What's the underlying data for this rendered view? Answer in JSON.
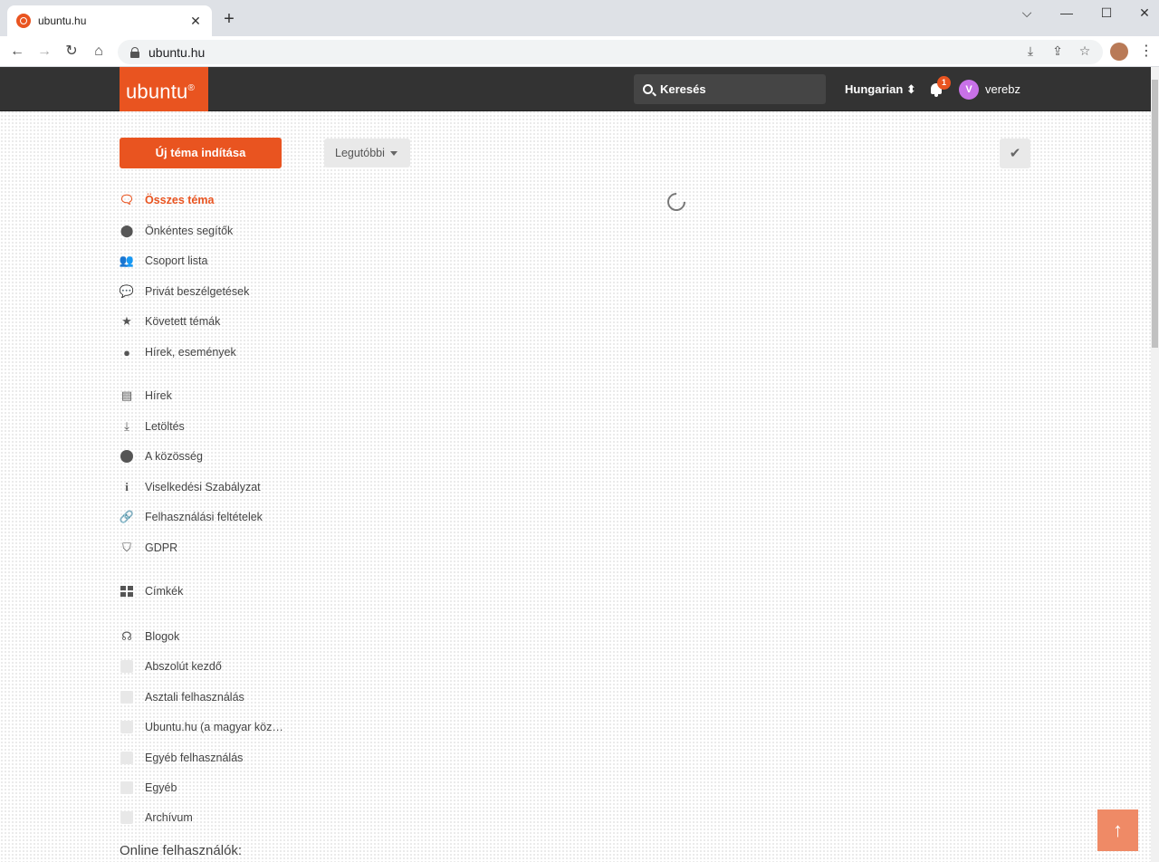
{
  "browser": {
    "tab_title": "ubuntu.hu",
    "tab_close": "✕",
    "new_tab": "+",
    "url": "ubuntu.hu",
    "window_controls": {
      "dropdown": "⌵",
      "minimize": "—",
      "maximize": "☐",
      "close": "✕"
    }
  },
  "header": {
    "logo_text": "ubuntu",
    "logo_mark": "®",
    "search_placeholder": "Keresés",
    "language": "Hungarian ⬍",
    "notification_count": "1",
    "avatar_letter": "V",
    "username": "verebz"
  },
  "main": {
    "new_topic_label": "Új téma indítása",
    "sort_label": "Legutóbbi",
    "check_symbol": "✔"
  },
  "sidebar": {
    "items": [
      {
        "label": "Összes téma",
        "icon": "chat-bubbles-icon",
        "active": true
      },
      {
        "label": "Önkéntes segítők",
        "icon": "map-pin-icon"
      },
      {
        "label": "Csoport lista",
        "icon": "users-icon"
      },
      {
        "label": "Privát beszélgetések",
        "icon": "comments-icon"
      },
      {
        "label": "Követett témák",
        "icon": "star-icon"
      },
      {
        "label": "Hírek, események",
        "icon": "comment-icon"
      },
      {
        "label": "Hírek",
        "icon": "newspaper-icon"
      },
      {
        "label": "Letöltés",
        "icon": "download-icon"
      },
      {
        "label": "A közösség",
        "icon": "circle-icon"
      },
      {
        "label": "Viselkedési Szabályzat",
        "icon": "info-icon"
      },
      {
        "label": "Felhasználási feltételek",
        "icon": "link-icon"
      },
      {
        "label": "GDPR",
        "icon": "shield-icon"
      },
      {
        "label": "Címkék",
        "icon": "tags-grid-icon"
      },
      {
        "label": "Blogok",
        "icon": "rss-icon"
      },
      {
        "label": "Abszolút kezdő",
        "icon": "category-square-icon"
      },
      {
        "label": "Asztali felhasználás",
        "icon": "category-square-icon"
      },
      {
        "label": "Ubuntu.hu (a magyar köz…",
        "icon": "category-square-icon"
      },
      {
        "label": "Egyéb felhasználás",
        "icon": "category-square-icon"
      },
      {
        "label": "Egyéb",
        "icon": "category-square-icon"
      },
      {
        "label": "Archívum",
        "icon": "category-square-icon"
      }
    ],
    "online_users_label": "Online felhasználók:"
  },
  "scroll_top_symbol": "↑",
  "colors": {
    "brand": "#e95420",
    "header_bg": "#333333",
    "avatar": "#c871e8"
  }
}
